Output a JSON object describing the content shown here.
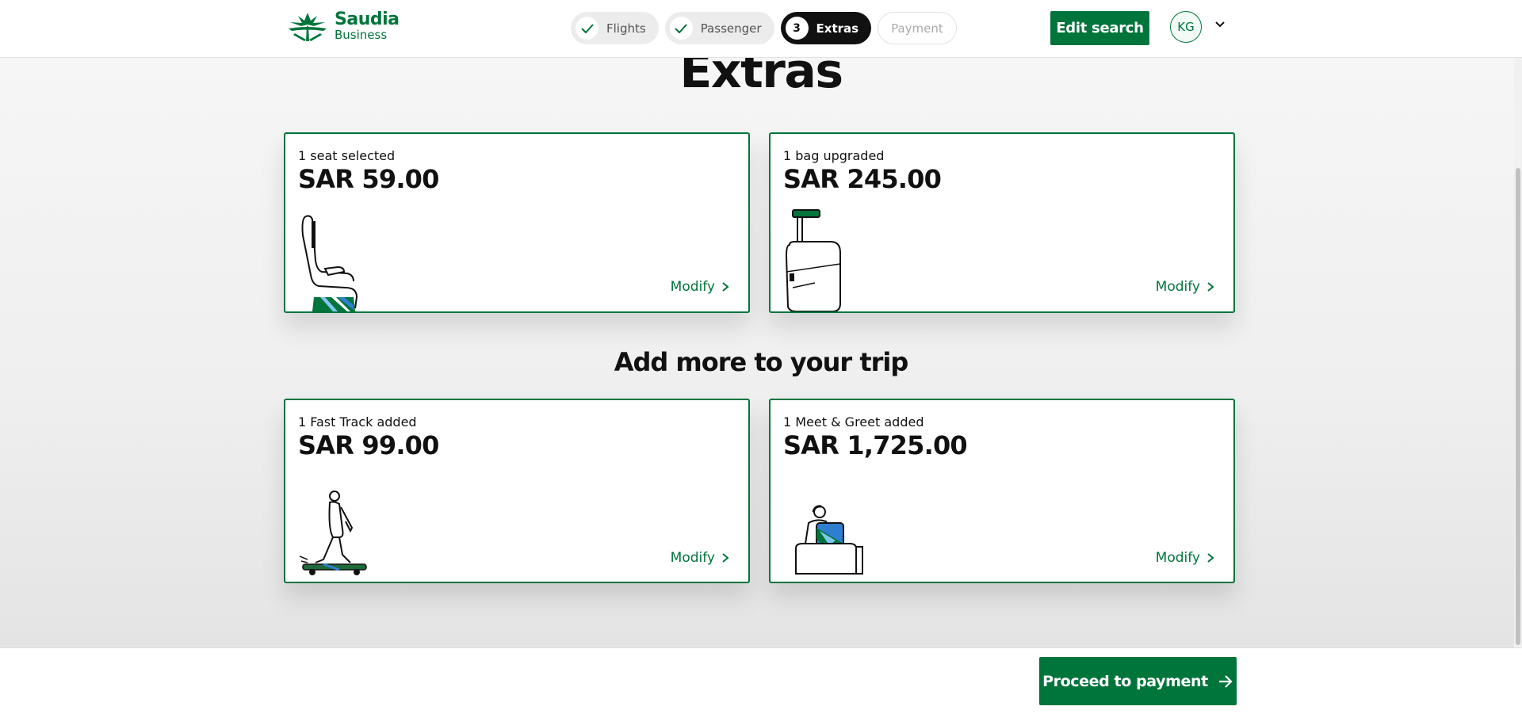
{
  "brand": {
    "name": "Saudia",
    "sub": "Business"
  },
  "steps": [
    {
      "label": "Flights",
      "state": "done"
    },
    {
      "label": "Passenger",
      "state": "done"
    },
    {
      "label": "Extras",
      "state": "active",
      "number": "3"
    },
    {
      "label": "Payment",
      "state": "disabled"
    }
  ],
  "header": {
    "edit_search": "Edit search",
    "avatar_initials": "KG"
  },
  "page": {
    "title": "Extras",
    "section_title": "Add more to your trip"
  },
  "cards": [
    {
      "label": "1 seat selected",
      "price": "SAR 59.00",
      "action": "Modify",
      "icon": "seat-illustration"
    },
    {
      "label": "1 bag upgraded",
      "price": "SAR 245.00",
      "action": "Modify",
      "icon": "luggage-illustration"
    },
    {
      "label": "1 Fast Track added",
      "price": "SAR 99.00",
      "action": "Modify",
      "icon": "fast-track-illustration"
    },
    {
      "label": "1 Meet & Greet added",
      "price": "SAR 1,725.00",
      "action": "Modify",
      "icon": "meet-greet-illustration"
    }
  ],
  "footer": {
    "proceed": "Proceed to payment"
  },
  "colors": {
    "brand_green": "#00753b",
    "active_step": "#111111"
  }
}
